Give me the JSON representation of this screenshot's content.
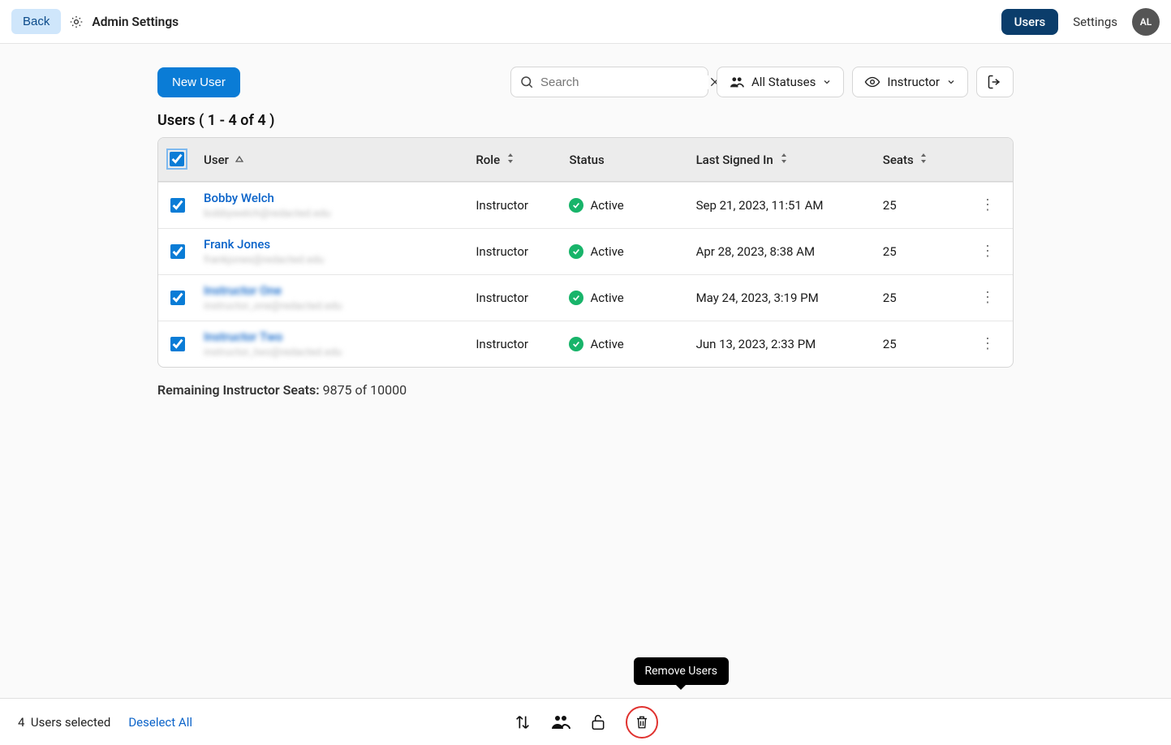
{
  "header": {
    "back": "Back",
    "title": "Admin Settings",
    "nav_users": "Users",
    "nav_settings": "Settings",
    "avatar_initials": "AL"
  },
  "toolbar": {
    "new_user": "New User",
    "search_placeholder": "Search",
    "filter_status": "All Statuses",
    "filter_role": "Instructor"
  },
  "list": {
    "title": "Users ( 1 - 4 of 4 )",
    "columns": {
      "user": "User",
      "role": "Role",
      "status": "Status",
      "last_signed_in": "Last Signed In",
      "seats": "Seats"
    },
    "rows": [
      {
        "name": "Bobby Welch",
        "blurred": false,
        "sub": "bobbywelch@redacted.edu",
        "role": "Instructor",
        "status": "Active",
        "last": "Sep 21, 2023, 11:51 AM",
        "seats": "25"
      },
      {
        "name": "Frank Jones",
        "blurred": false,
        "sub": "frankjones@redacted.edu",
        "role": "Instructor",
        "status": "Active",
        "last": "Apr 28, 2023, 8:38 AM",
        "seats": "25"
      },
      {
        "name": "Instructor One",
        "blurred": true,
        "sub": "instructor_one@redacted.edu",
        "role": "Instructor",
        "status": "Active",
        "last": "May 24, 2023, 3:19 PM",
        "seats": "25"
      },
      {
        "name": "Instructor Two",
        "blurred": true,
        "sub": "instructor_two@redacted.edu",
        "role": "Instructor",
        "status": "Active",
        "last": "Jun 13, 2023, 2:33 PM",
        "seats": "25"
      }
    ]
  },
  "remaining": {
    "label": "Remaining Instructor Seats:",
    "value": "9875 of 10000"
  },
  "selection": {
    "count_prefix": "4",
    "count_label": "Users selected",
    "deselect": "Deselect All",
    "tooltip": "Remove Users"
  }
}
